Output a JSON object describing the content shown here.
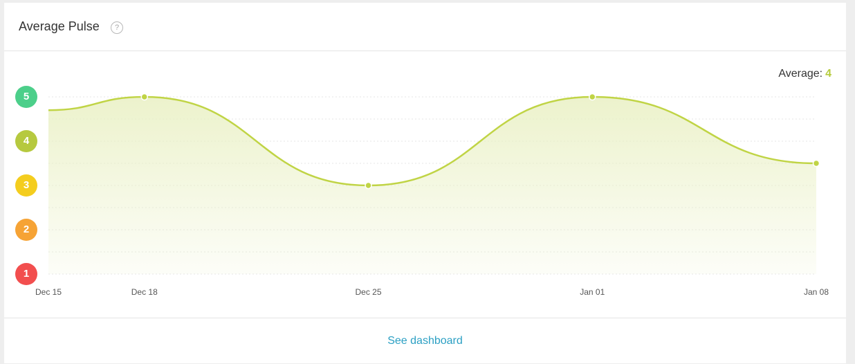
{
  "card": {
    "title": "Average Pulse",
    "help_icon": "?",
    "footer_link": "See dashboard"
  },
  "average": {
    "label": "Average:",
    "value": "4"
  },
  "colors": {
    "line": "#c0d445",
    "fill": "#e9f0c3",
    "grid": "#e6e6e6",
    "level_5": "#4ccf8a",
    "level_4": "#b6c93f",
    "level_3": "#f4cd1e",
    "level_2": "#f6a335",
    "level_1": "#f24e4e",
    "link": "#2a9fc3"
  },
  "chart_data": {
    "type": "area",
    "x": [
      "Dec 15",
      "Dec 18",
      "Dec 25",
      "Jan 01",
      "Jan 08"
    ],
    "x_days_from_start": [
      0,
      3,
      10,
      17,
      24
    ],
    "values": [
      4.7,
      5,
      3,
      5,
      3.5
    ],
    "marked_points": [
      1,
      2,
      3,
      4
    ],
    "ylim": [
      1,
      5
    ],
    "y_levels": [
      {
        "label": "5",
        "value": 5,
        "color": "#4ccf8a"
      },
      {
        "label": "4",
        "value": 4,
        "color": "#b6c93f"
      },
      {
        "label": "3",
        "value": 3,
        "color": "#f4cd1e"
      },
      {
        "label": "2",
        "value": 2,
        "color": "#f6a335"
      },
      {
        "label": "1",
        "value": 1,
        "color": "#f24e4e"
      }
    ],
    "grid": true,
    "xlabel": "",
    "ylabel": ""
  }
}
